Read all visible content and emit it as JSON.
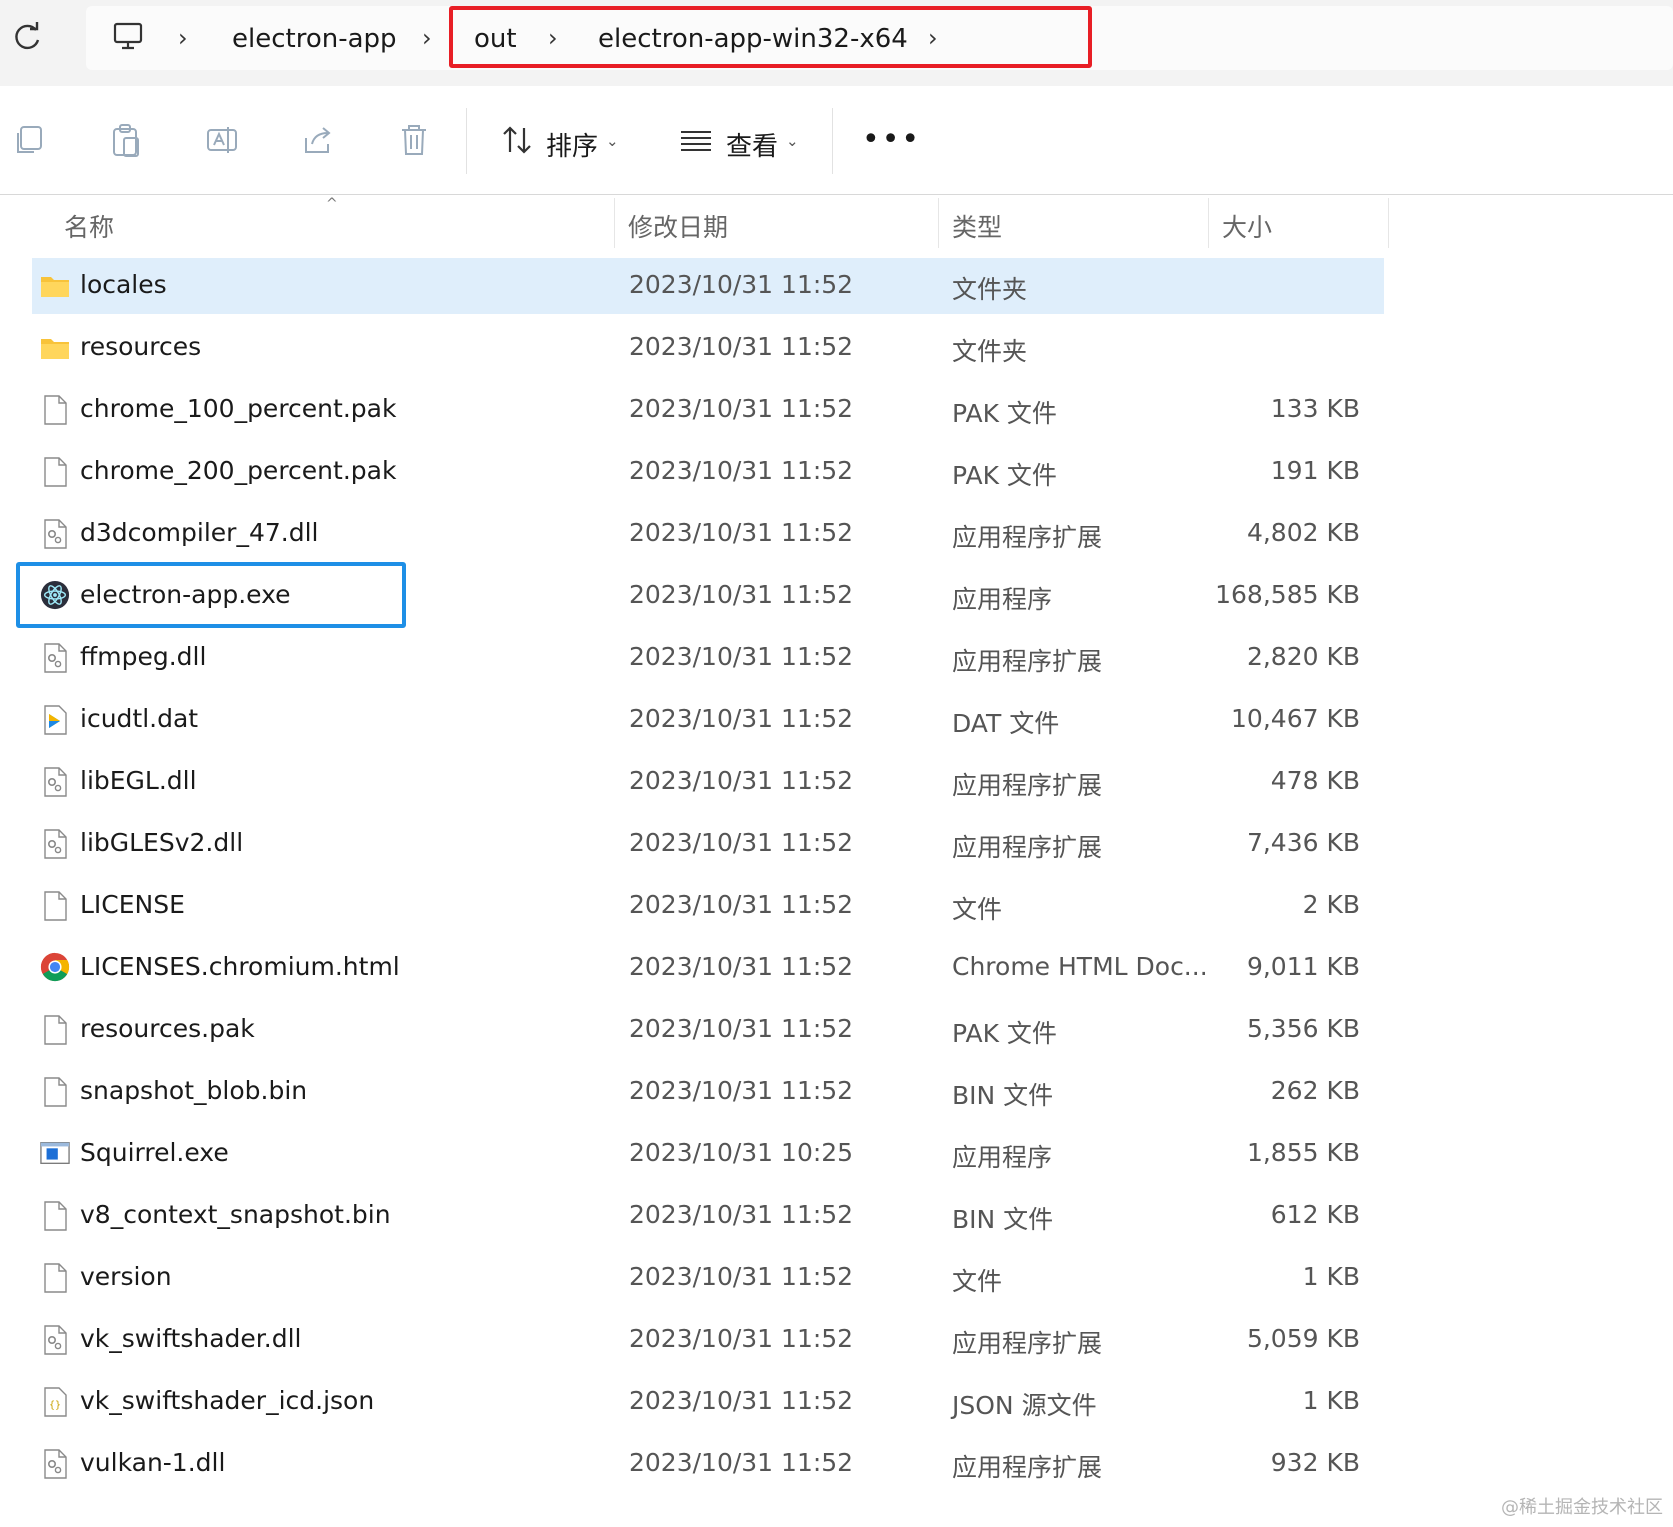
{
  "address_bar": {
    "crumbs": [
      "electron-app",
      "out",
      "electron-app-win32-x64"
    ]
  },
  "toolbar": {
    "sort_label": "排序",
    "view_label": "查看",
    "more_label": "•••"
  },
  "columns": {
    "name": "名称",
    "date": "修改日期",
    "type": "类型",
    "size": "大小"
  },
  "files": [
    {
      "name": "locales",
      "date": "2023/10/31 11:52",
      "type": "文件夹",
      "size": "",
      "icon": "folder-icon",
      "selected": true
    },
    {
      "name": "resources",
      "date": "2023/10/31 11:52",
      "type": "文件夹",
      "size": "",
      "icon": "folder-icon"
    },
    {
      "name": "chrome_100_percent.pak",
      "date": "2023/10/31 11:52",
      "type": "PAK 文件",
      "size": "133 KB",
      "icon": "file-icon"
    },
    {
      "name": "chrome_200_percent.pak",
      "date": "2023/10/31 11:52",
      "type": "PAK 文件",
      "size": "191 KB",
      "icon": "file-icon"
    },
    {
      "name": "d3dcompiler_47.dll",
      "date": "2023/10/31 11:52",
      "type": "应用程序扩展",
      "size": "4,802 KB",
      "icon": "dll-icon"
    },
    {
      "name": "electron-app.exe",
      "date": "2023/10/31 11:52",
      "type": "应用程序",
      "size": "168,585 KB",
      "icon": "electron-icon",
      "highlighted": true
    },
    {
      "name": "ffmpeg.dll",
      "date": "2023/10/31 11:52",
      "type": "应用程序扩展",
      "size": "2,820 KB",
      "icon": "dll-icon"
    },
    {
      "name": "icudtl.dat",
      "date": "2023/10/31 11:52",
      "type": "DAT 文件",
      "size": "10,467 KB",
      "icon": "media-file-icon"
    },
    {
      "name": "libEGL.dll",
      "date": "2023/10/31 11:52",
      "type": "应用程序扩展",
      "size": "478 KB",
      "icon": "dll-icon"
    },
    {
      "name": "libGLESv2.dll",
      "date": "2023/10/31 11:52",
      "type": "应用程序扩展",
      "size": "7,436 KB",
      "icon": "dll-icon"
    },
    {
      "name": "LICENSE",
      "date": "2023/10/31 11:52",
      "type": "文件",
      "size": "2 KB",
      "icon": "file-icon"
    },
    {
      "name": "LICENSES.chromium.html",
      "date": "2023/10/31 11:52",
      "type": "Chrome HTML Doc...",
      "size": "9,011 KB",
      "icon": "chrome-icon"
    },
    {
      "name": "resources.pak",
      "date": "2023/10/31 11:52",
      "type": "PAK 文件",
      "size": "5,356 KB",
      "icon": "file-icon"
    },
    {
      "name": "snapshot_blob.bin",
      "date": "2023/10/31 11:52",
      "type": "BIN 文件",
      "size": "262 KB",
      "icon": "file-icon"
    },
    {
      "name": "Squirrel.exe",
      "date": "2023/10/31 10:25",
      "type": "应用程序",
      "size": "1,855 KB",
      "icon": "exe-icon"
    },
    {
      "name": "v8_context_snapshot.bin",
      "date": "2023/10/31 11:52",
      "type": "BIN 文件",
      "size": "612 KB",
      "icon": "file-icon"
    },
    {
      "name": "version",
      "date": "2023/10/31 11:52",
      "type": "文件",
      "size": "1 KB",
      "icon": "file-icon"
    },
    {
      "name": "vk_swiftshader.dll",
      "date": "2023/10/31 11:52",
      "type": "应用程序扩展",
      "size": "5,059 KB",
      "icon": "dll-icon"
    },
    {
      "name": "vk_swiftshader_icd.json",
      "date": "2023/10/31 11:52",
      "type": "JSON 源文件",
      "size": "1 KB",
      "icon": "json-icon"
    },
    {
      "name": "vulkan-1.dll",
      "date": "2023/10/31 11:52",
      "type": "应用程序扩展",
      "size": "932 KB",
      "icon": "dll-icon"
    }
  ],
  "watermark": "@稀土掘金技术社区",
  "colors": {
    "selection": "#dfeefb",
    "highlight_blue": "#1e8fe6",
    "highlight_red": "#e81e25"
  }
}
